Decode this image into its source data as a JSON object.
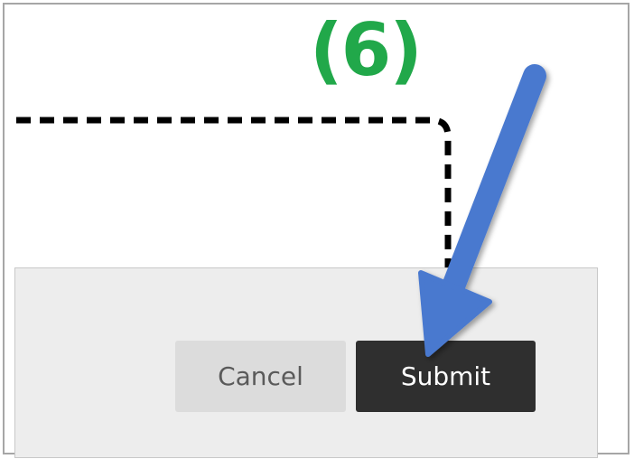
{
  "annotation": {
    "step_label": "(6)",
    "step_color": "#21a84a",
    "arrow_color": "#4a79cf",
    "arrow_icon": "pointer-arrow-icon"
  },
  "dialog": {
    "cancel_label": "Cancel",
    "submit_label": "Submit",
    "submit_bg": "#2f2f2f",
    "cancel_bg": "#dcdcdc",
    "footer_bg": "#ededed"
  }
}
